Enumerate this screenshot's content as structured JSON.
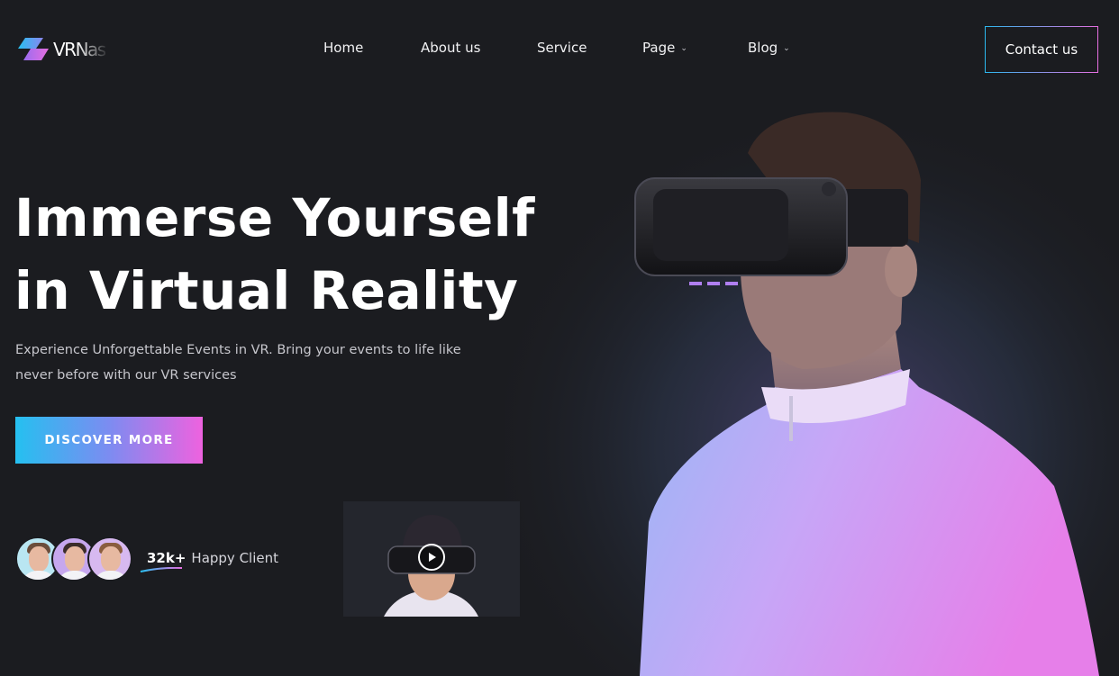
{
  "brand": {
    "name": "VRNas"
  },
  "nav": {
    "items": [
      {
        "label": "Home",
        "dropdown": false
      },
      {
        "label": "About us",
        "dropdown": false
      },
      {
        "label": "Service",
        "dropdown": false
      },
      {
        "label": "Page",
        "dropdown": true
      },
      {
        "label": "Blog",
        "dropdown": true
      }
    ],
    "dropdown_icon": "chevron-down-icon"
  },
  "header": {
    "contact_label": "Contact us"
  },
  "hero": {
    "title_line1": "Immerse Yourself",
    "title_line2": "in Virtual Reality",
    "subtitle": "Experience Unforgettable Events in VR. Bring your events to life like never before with our VR services",
    "cta_label": "DISCOVER MORE"
  },
  "clients": {
    "count": "32k+",
    "label": "Happy Client",
    "avatar_count": 3
  },
  "video": {
    "icon": "play-icon"
  },
  "colors": {
    "background": "#1b1c20",
    "accent_cyan": "#25c0f0",
    "accent_pink": "#ee62df",
    "accent_purple": "#7c8cf1"
  }
}
